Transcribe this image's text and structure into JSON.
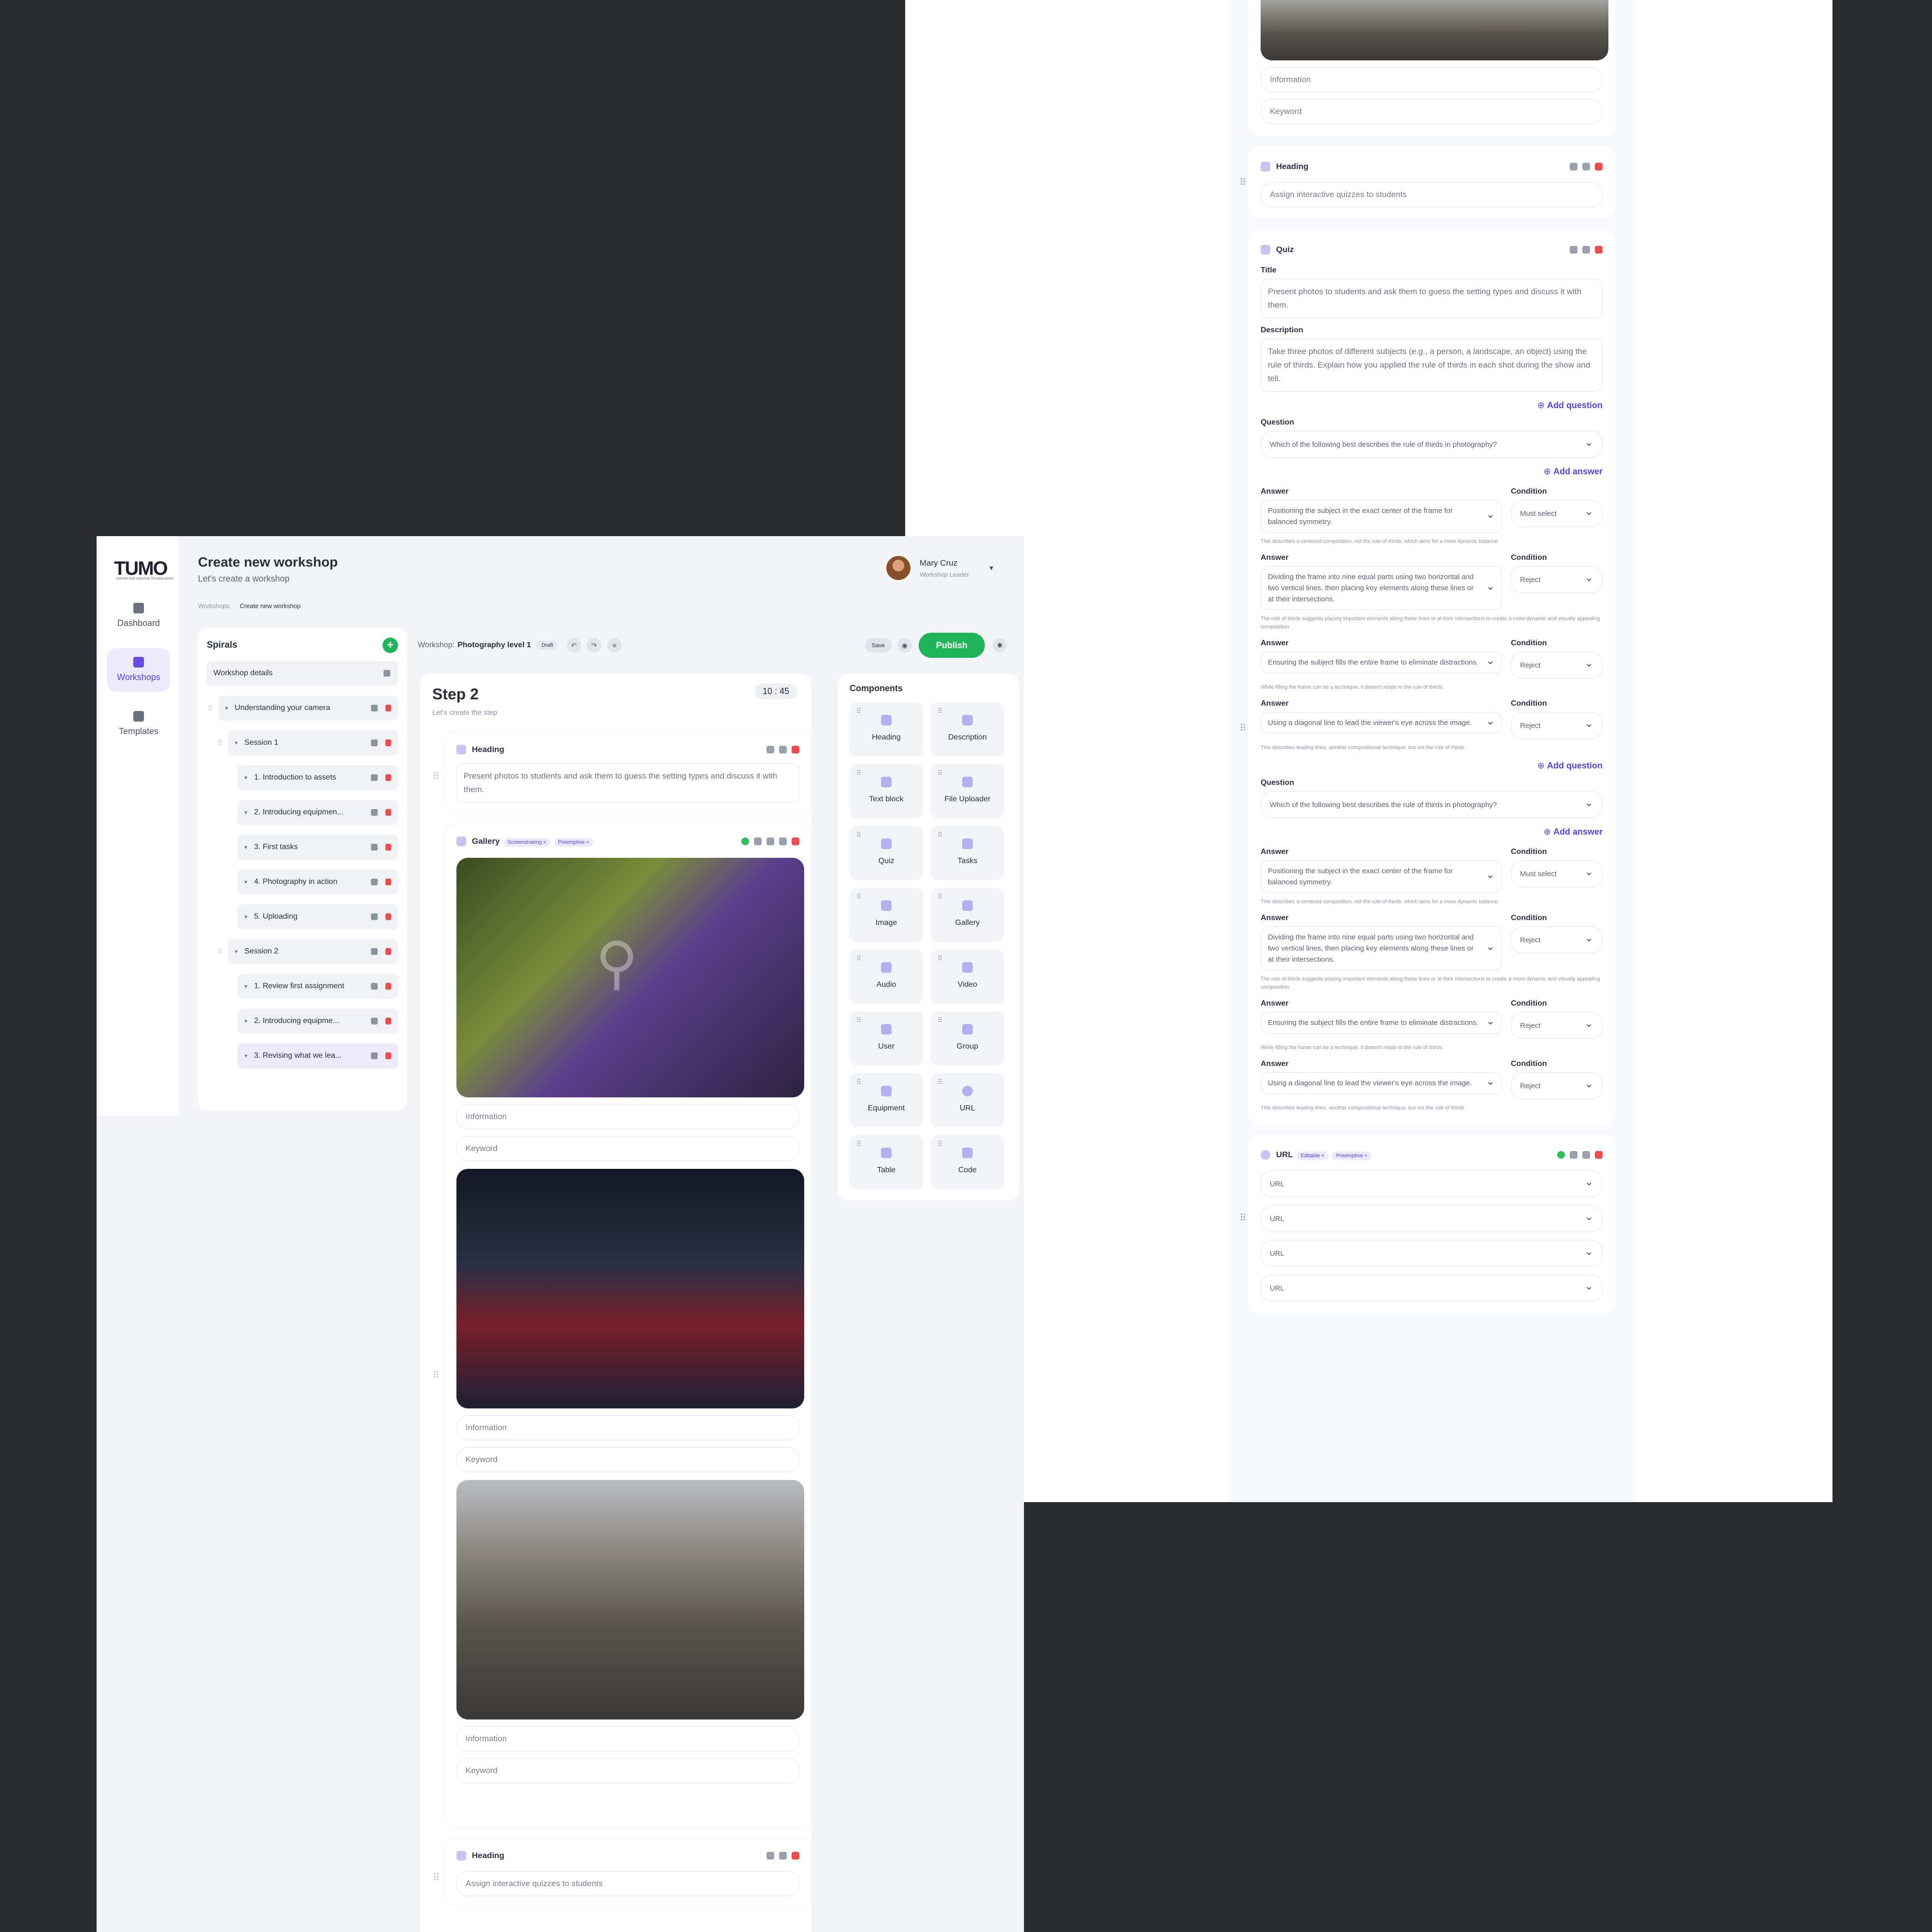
{
  "right": {
    "info_placeholder": "Information",
    "keyword_placeholder": "Keyword",
    "heading_card": {
      "title": "Heading",
      "value": "Assign interactive quizzes to students"
    },
    "quiz": {
      "title": "Quiz",
      "title_label": "Title",
      "title_value": "Present photos to students and ask them to guess the setting types and discuss it with them.",
      "description_label": "Description",
      "description_value": "Take three photos of different subjects (e.g., a person, a landscape, an object) using the rule of thirds. Explain how you applied the rule of thirds in each shot during the show and tell.",
      "add_question": "Add question",
      "add_answer": "Add answer",
      "question_label": "Question",
      "answer_label": "Answer",
      "condition_label": "Condition",
      "questions": [
        {
          "text": "Which of the following best describes the rule of thirds in photography?",
          "answers": [
            {
              "text": "Positioning the subject in the exact center of the frame for balanced symmetry.",
              "condition": "Must select",
              "note": "This describes a centered composition, not the rule of thirds, which aims for a more dynamic balance."
            },
            {
              "text": "Dividing the frame into nine equal parts using two horizontal and two vertical lines, then placing key elements along these lines or at their intersections.",
              "condition": "Reject",
              "note": "The rule of thirds suggests placing important elements along these lines or at their intersections to create a more dynamic and visually appealing composition."
            },
            {
              "text": "Ensuring the subject fills the entire frame to eliminate distractions.",
              "condition": "Reject",
              "note": "While filling the frame can be a technique, it doesn't relate to the rule of thirds."
            },
            {
              "text": "Using a diagonal line to lead the viewer's eye across the image.",
              "condition": "Reject",
              "note": "This describes leading lines, another compositional technique, but not the rule of thirds."
            }
          ]
        },
        {
          "text": "Which of the following best describes the rule of thirds in photography?",
          "answers": [
            {
              "text": "Positioning the subject in the exact center of the frame for balanced symmetry.",
              "condition": "Must select",
              "note": "This describes a centered composition, not the rule of thirds, which aims for a more dynamic balance."
            },
            {
              "text": "Dividing the frame into nine equal parts using two horizontal and two vertical lines, then placing key elements along these lines or at their intersections.",
              "condition": "Reject",
              "note": "The rule of thirds suggests placing important elements along these lines or at their intersections to create a more dynamic and visually appealing composition."
            },
            {
              "text": "Ensuring the subject fills the entire frame to eliminate distractions.",
              "condition": "Reject",
              "note": "While filling the frame can be a technique, it doesn't relate to the rule of thirds."
            },
            {
              "text": "Using a diagonal line to lead the viewer's eye across the image.",
              "condition": "Reject",
              "note": "This describes leading lines, another compositional technique, but not the rule of thirds."
            }
          ]
        }
      ]
    },
    "url_card": {
      "title": "URL",
      "chips": [
        "Editable ×",
        "Preemptive ×"
      ],
      "placeholder": "URL"
    }
  },
  "app": {
    "logo": "TUMO",
    "logo_sub": "CENTER FOR CREATIVE TECHNOLOGIES",
    "nav": [
      "Dashboard",
      "Workshops",
      "Templates"
    ],
    "title": "Create new workshop",
    "subtitle": "Let's create a workshop",
    "breadcrumb": [
      "Workshops",
      "Create new workshop"
    ],
    "user": {
      "name": "Mary Cruz",
      "role": "Workshop Leader"
    },
    "spirals": {
      "title": "Spirals",
      "details": "Workshop details",
      "tree": [
        "Understanding your camera",
        "Session 1",
        "1. Introduction to assets",
        "2. Introducing equipmen...",
        "3. First tasks",
        "4. Photography in action",
        "5. Uploading",
        "Session 2",
        "1. Review first assignment",
        "2. Introducing equipme...",
        "3. Revising what we lea..."
      ]
    },
    "toolbar": {
      "workshop_label": "Workshop:",
      "workshop_name": "Photography level 1",
      "status": "Draft",
      "save": "Save",
      "publish": "Publish"
    },
    "step": {
      "title": "Step 2",
      "subtitle": "Let's create the step",
      "timer_min": "10",
      "timer_sep": ":",
      "timer_sec": "45",
      "heading1": {
        "title": "Heading",
        "value": "Present photos to students and ask them to guess the setting types and discuss it with them."
      },
      "gallery": {
        "title": "Gallery",
        "chips": [
          "Screensharing ×",
          "Preemptive ×"
        ]
      },
      "heading2": {
        "title": "Heading",
        "value": "Assign interactive quizzes to students"
      }
    },
    "components": {
      "title": "Components",
      "items": [
        "Heading",
        "Description",
        "Text block",
        "File Uploader",
        "Quiz",
        "Tasks",
        "Image",
        "Gallery",
        "Audio",
        "Video",
        "User",
        "Group",
        "Equipment",
        "URL",
        "Table",
        "Code"
      ]
    }
  }
}
